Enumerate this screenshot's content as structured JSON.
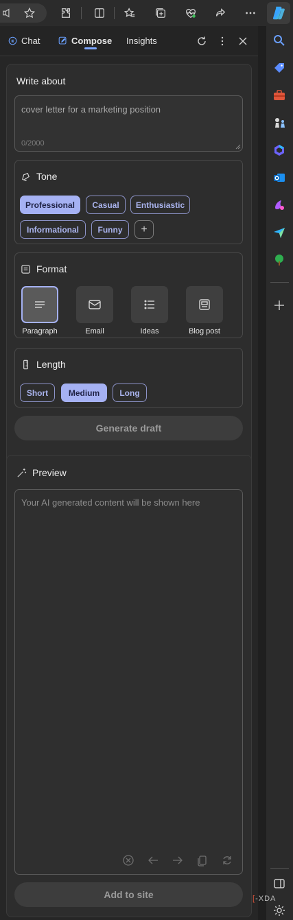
{
  "toolbar": {
    "icons": [
      "read-aloud-icon",
      "favorite-star-icon",
      "extensions-icon",
      "split-screen-icon",
      "favorites-icon",
      "collections-icon",
      "browser-essentials-icon",
      "share-icon",
      "more-icon",
      "copilot-icon"
    ]
  },
  "pane": {
    "tabs": [
      {
        "label": "Chat",
        "active": false
      },
      {
        "label": "Compose",
        "active": true
      },
      {
        "label": "Insights",
        "active": false
      }
    ]
  },
  "compose": {
    "write_about_title": "Write about",
    "input_value": "cover letter for a marketing position",
    "char_count": "0/2000",
    "tone": {
      "title": "Tone",
      "options": [
        "Professional",
        "Casual",
        "Enthusiastic",
        "Informational",
        "Funny"
      ],
      "selected": "Professional",
      "add_label": "+"
    },
    "format": {
      "title": "Format",
      "options": [
        "Paragraph",
        "Email",
        "Ideas",
        "Blog post"
      ],
      "selected": "Paragraph"
    },
    "length": {
      "title": "Length",
      "options": [
        "Short",
        "Medium",
        "Long"
      ],
      "selected": "Medium"
    },
    "generate_label": "Generate draft"
  },
  "preview": {
    "title": "Preview",
    "placeholder": "Your AI generated content will be shown here",
    "add_to_site_label": "Add to site"
  },
  "watermark": "XDA",
  "colors": {
    "accent": "#a5b1f3",
    "chip_border": "#8c93c8",
    "tab_underline": "#7ea7ff"
  }
}
